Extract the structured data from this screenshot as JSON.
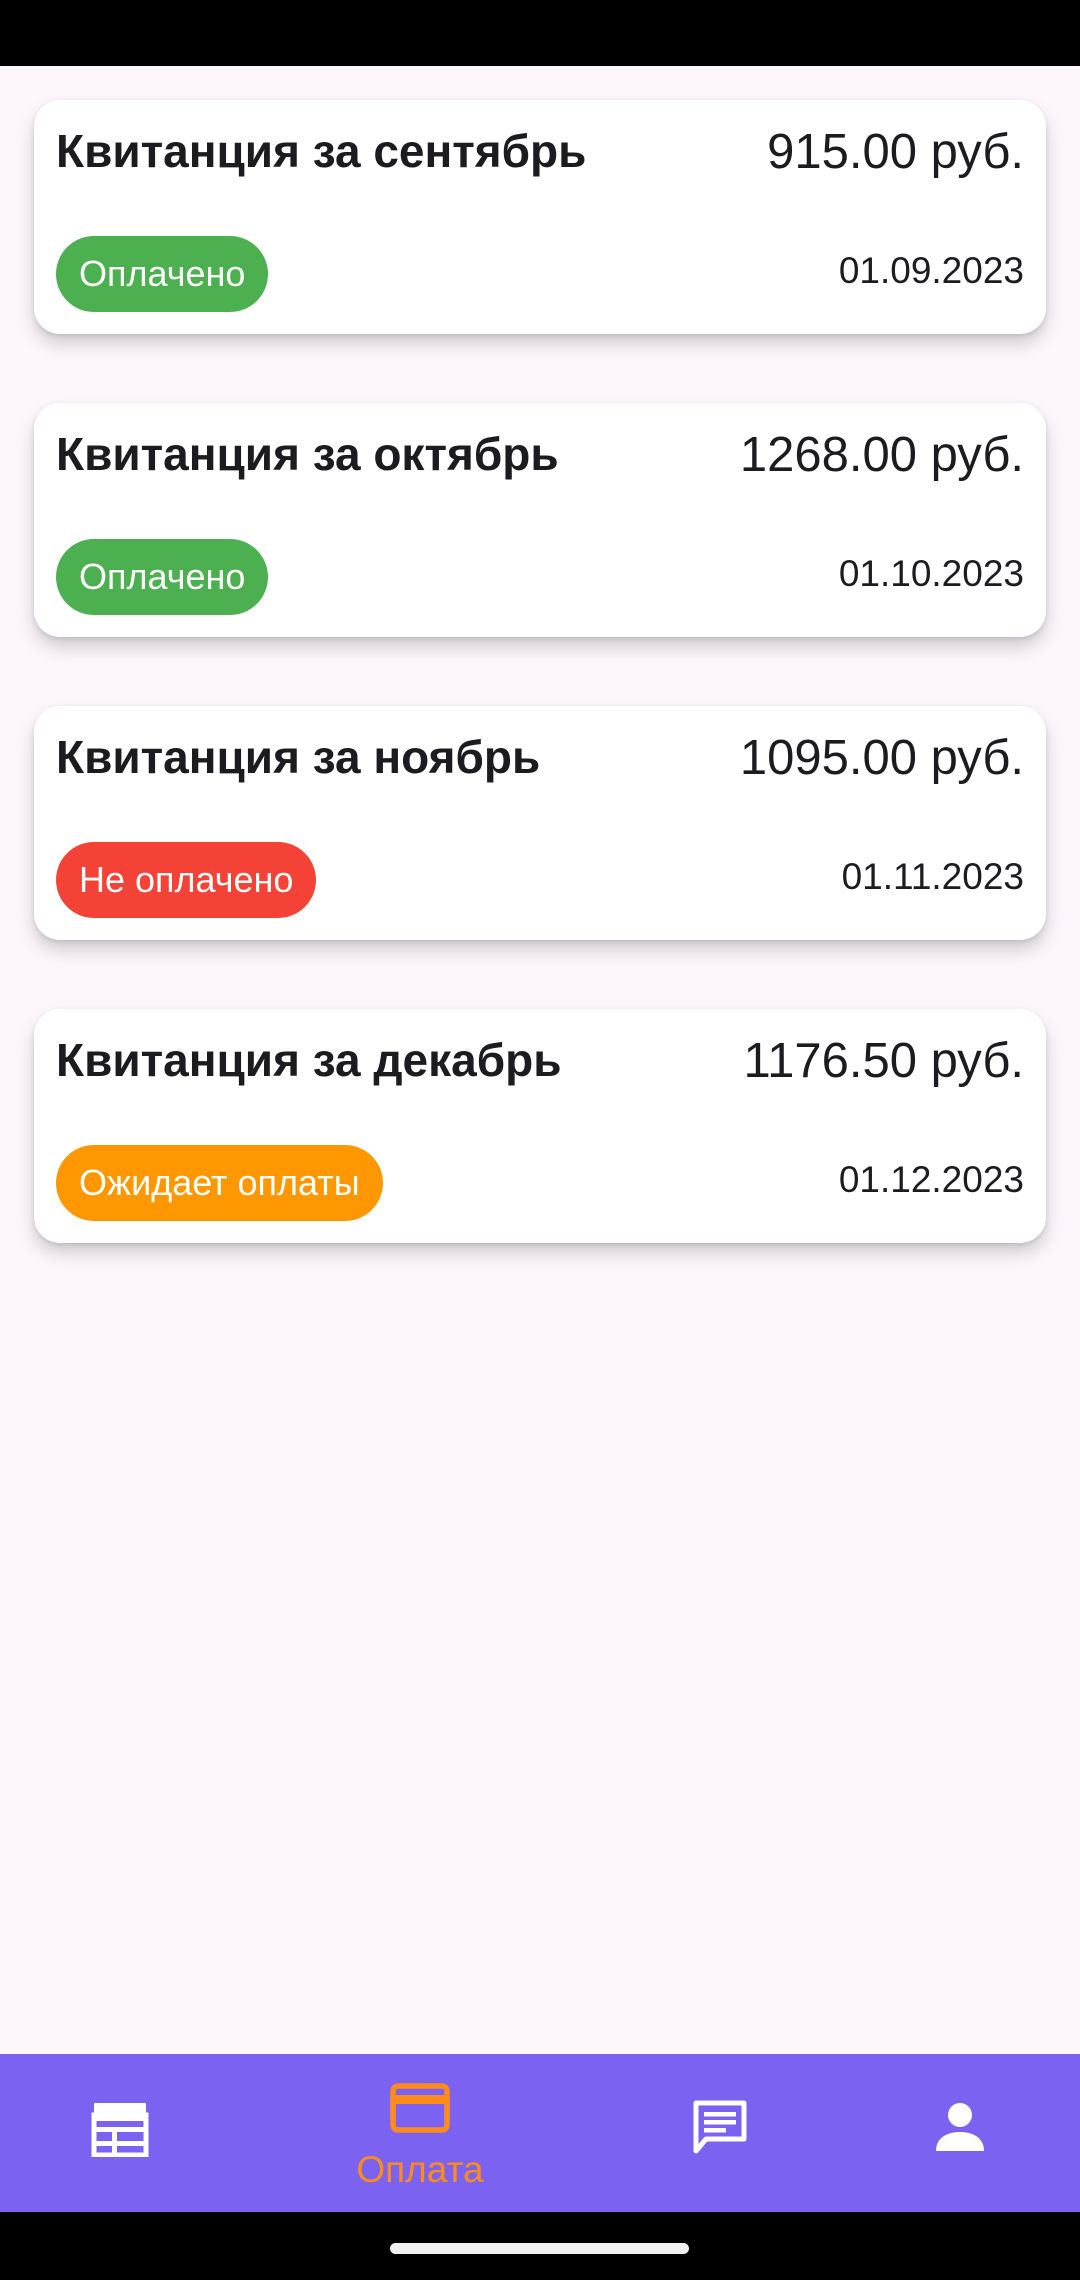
{
  "colors": {
    "paid": "#4caf50",
    "unpaid": "#f44336",
    "pending": "#ff9800",
    "nav_background": "#7b62f0",
    "nav_active": "#ff8c1a",
    "nav_inactive": "#ffffff"
  },
  "receipts": [
    {
      "title": "Квитанция за сентябрь",
      "amount": "915.00 руб.",
      "status": "Оплачено",
      "status_type": "paid",
      "date": "01.09.2023"
    },
    {
      "title": "Квитанция за октябрь",
      "amount": "1268.00 руб.",
      "status": "Оплачено",
      "status_type": "paid",
      "date": "01.10.2023"
    },
    {
      "title": "Квитанция за ноябрь",
      "amount": "1095.00 руб.",
      "status": "Не оплачено",
      "status_type": "unpaid",
      "date": "01.11.2023"
    },
    {
      "title": "Квитанция за декабрь",
      "amount": "1176.50 руб.",
      "status": "Ожидает оплаты",
      "status_type": "pending",
      "date": "01.12.2023"
    }
  ],
  "bottom_nav": {
    "items": [
      {
        "icon": "newspaper-icon",
        "label": "",
        "active": false
      },
      {
        "icon": "credit-card-icon",
        "label": "Оплата",
        "active": true
      },
      {
        "icon": "chat-icon",
        "label": "",
        "active": false
      },
      {
        "icon": "person-icon",
        "label": "",
        "active": false
      }
    ]
  }
}
